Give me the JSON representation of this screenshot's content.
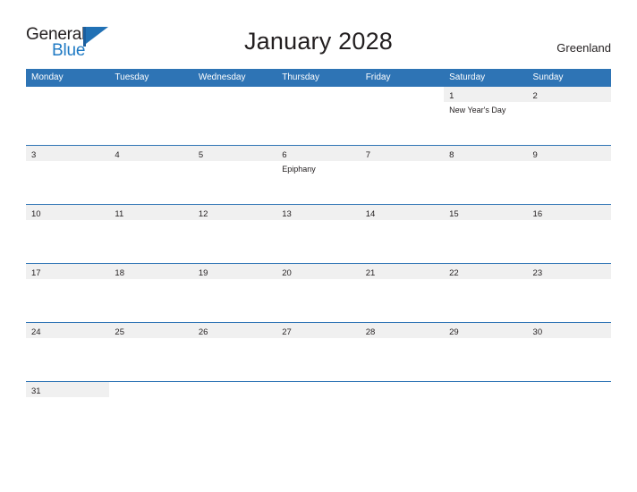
{
  "brand": {
    "name_part1": "General",
    "name_part2": "Blue",
    "mark": "flag-triangle",
    "color_dark": "#231f20",
    "color_blue": "#1f7ac4"
  },
  "header": {
    "title": "January 2028",
    "locale": "Greenland"
  },
  "theme": {
    "header_blue": "#2e74b5",
    "band_gray": "#f0f0f0",
    "text": "#231f20"
  },
  "weekdays": [
    "Monday",
    "Tuesday",
    "Wednesday",
    "Thursday",
    "Friday",
    "Saturday",
    "Sunday"
  ],
  "weeks": [
    [
      {
        "day": "",
        "events": []
      },
      {
        "day": "",
        "events": []
      },
      {
        "day": "",
        "events": []
      },
      {
        "day": "",
        "events": []
      },
      {
        "day": "",
        "events": []
      },
      {
        "day": "1",
        "events": [
          "New Year's Day"
        ]
      },
      {
        "day": "2",
        "events": []
      }
    ],
    [
      {
        "day": "3",
        "events": []
      },
      {
        "day": "4",
        "events": []
      },
      {
        "day": "5",
        "events": []
      },
      {
        "day": "6",
        "events": [
          "Epiphany"
        ]
      },
      {
        "day": "7",
        "events": []
      },
      {
        "day": "8",
        "events": []
      },
      {
        "day": "9",
        "events": []
      }
    ],
    [
      {
        "day": "10",
        "events": []
      },
      {
        "day": "11",
        "events": []
      },
      {
        "day": "12",
        "events": []
      },
      {
        "day": "13",
        "events": []
      },
      {
        "day": "14",
        "events": []
      },
      {
        "day": "15",
        "events": []
      },
      {
        "day": "16",
        "events": []
      }
    ],
    [
      {
        "day": "17",
        "events": []
      },
      {
        "day": "18",
        "events": []
      },
      {
        "day": "19",
        "events": []
      },
      {
        "day": "20",
        "events": []
      },
      {
        "day": "21",
        "events": []
      },
      {
        "day": "22",
        "events": []
      },
      {
        "day": "23",
        "events": []
      }
    ],
    [
      {
        "day": "24",
        "events": []
      },
      {
        "day": "25",
        "events": []
      },
      {
        "day": "26",
        "events": []
      },
      {
        "day": "27",
        "events": []
      },
      {
        "day": "28",
        "events": []
      },
      {
        "day": "29",
        "events": []
      },
      {
        "day": "30",
        "events": []
      }
    ],
    [
      {
        "day": "31",
        "events": []
      },
      {
        "day": "",
        "events": []
      },
      {
        "day": "",
        "events": []
      },
      {
        "day": "",
        "events": []
      },
      {
        "day": "",
        "events": []
      },
      {
        "day": "",
        "events": []
      },
      {
        "day": "",
        "events": []
      }
    ]
  ]
}
